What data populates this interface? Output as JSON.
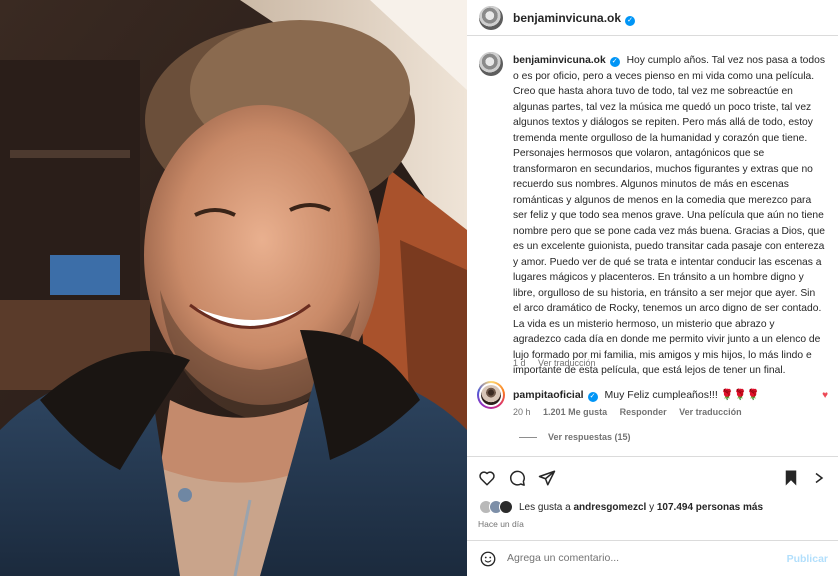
{
  "post": {
    "author": "benjaminvicuna.ok",
    "caption": "Hoy cumplo años. Tal vez nos pasa a todos o es por oficio, pero a veces pienso en mi vida como una película. Creo que hasta ahora tuvo de todo, tal vez me sobreactúe en algunas partes, tal vez la música me quedó un poco triste, tal vez algunos textos y diálogos se repiten. Pero más allá de todo, estoy tremenda mente orgulloso de la humanidad y corazón que tiene. Personajes hermosos que volaron, antagónicos que se transformaron en secundarios, muchos figurantes y extras que no recuerdo sus nombres. Algunos minutos de más en escenas románticas y algunos de menos en la comedia que merezco para ser feliz y que todo sea menos grave. Una película que aún no tiene nombre pero que se pone cada vez más buena. Gracias a Dios, que es un excelente guionista, puedo transitar cada pasaje con entereza y amor. Puedo ver de qué se trata e intentar conducir las escenas a lugares mágicos y placenteros. En tránsito a un hombre digno y libre, orgulloso de su historia, en tránsito a ser mejor que ayer. Sin el arco dramático de Rocky, tenemos un arco digno de ser contado. La vida es un misterio hermoso, un misterio que abrazo y agradezco cada día en donde me permito vivir junto a un elenco de lujo formado por mi familia, mis amigos y mis hijos, lo más lindo e importante de esta película, que está lejos de tener un final.",
    "caption_age": "1 d",
    "see_translation": "Ver traducción"
  },
  "comment": {
    "author": "pampitaoficial",
    "text": "Muy Feliz cumpleaños!!! 🌹🌹🌹",
    "age": "20 h",
    "likes": "1.201 Me gusta",
    "reply": "Responder",
    "see_translation": "Ver traducción",
    "view_replies": "Ver respuestas (15)"
  },
  "likes_line": {
    "prefix": "Les gusta a ",
    "user": "andresgomezcl",
    "middle": " y ",
    "count": "107.494 personas más"
  },
  "time_ago": "Hace un día",
  "comment_box": {
    "placeholder": "Agrega un comentario...",
    "publish": "Publicar"
  },
  "icons": [
    "heart-icon",
    "comment-icon",
    "share-icon",
    "bookmark-icon",
    "more-icon",
    "emoji-icon",
    "verified-icon"
  ],
  "colors": {
    "verified": "#0095f6",
    "like": "#ed4956",
    "publish": "#b2dffc",
    "muted": "#737373"
  }
}
